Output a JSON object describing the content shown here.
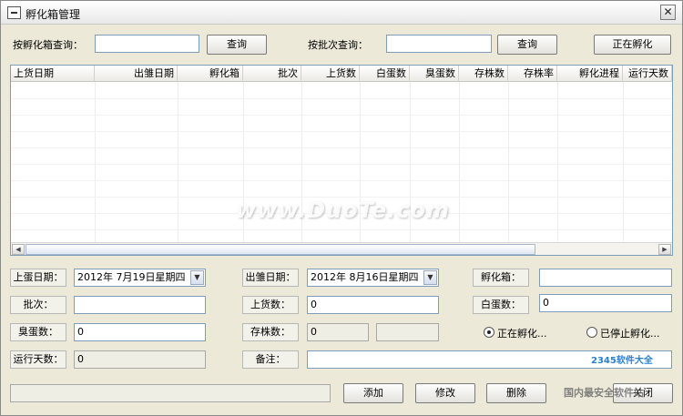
{
  "window": {
    "title": "孵化箱管理",
    "close_glyph": "✕"
  },
  "search": {
    "by_box_label": "按孵化箱查询：",
    "by_box_value": "",
    "query_button_1": "查询",
    "by_batch_label": "按批次查询：",
    "by_batch_value": "",
    "query_button_2": "查询",
    "incubating_button": "正在孵化"
  },
  "grid": {
    "columns": [
      "上货日期",
      "出雏日期",
      "孵化箱",
      "批次",
      "上货数",
      "白蛋数",
      "臭蛋数",
      "存株数",
      "存株率",
      "孵化进程",
      "运行天数"
    ],
    "rows": []
  },
  "form": {
    "load_date_label": "上蛋日期：",
    "load_date_value": "2012年  7月19日星期四",
    "hatch_date_label": "出雏日期：",
    "hatch_date_value": "2012年  8月16日星期四",
    "box_label": "孵化箱：",
    "box_value": "",
    "batch_label": "批次：",
    "batch_value": "",
    "loaded_count_label": "上货数：",
    "loaded_count_value": "0",
    "white_egg_label": "白蛋数：",
    "white_egg_value": "0",
    "bad_egg_label": "臭蛋数：",
    "bad_egg_value": "0",
    "survive_label": "存株数：",
    "survive_value": "0",
    "survive_rate_value": "",
    "run_days_label": "运行天数：",
    "run_days_value": "0",
    "note_label": "备注：",
    "note_value": "",
    "radio_incubating": "正在孵化...",
    "radio_stopped": "已停止孵化..."
  },
  "actions": {
    "add": "添加",
    "edit": "修改",
    "delete": "删除",
    "close": "关闭"
  },
  "watermark": {
    "site": "www.DuoTe.com",
    "corner": "2345软件大全",
    "corner_sub": "国内最安全软件站"
  }
}
